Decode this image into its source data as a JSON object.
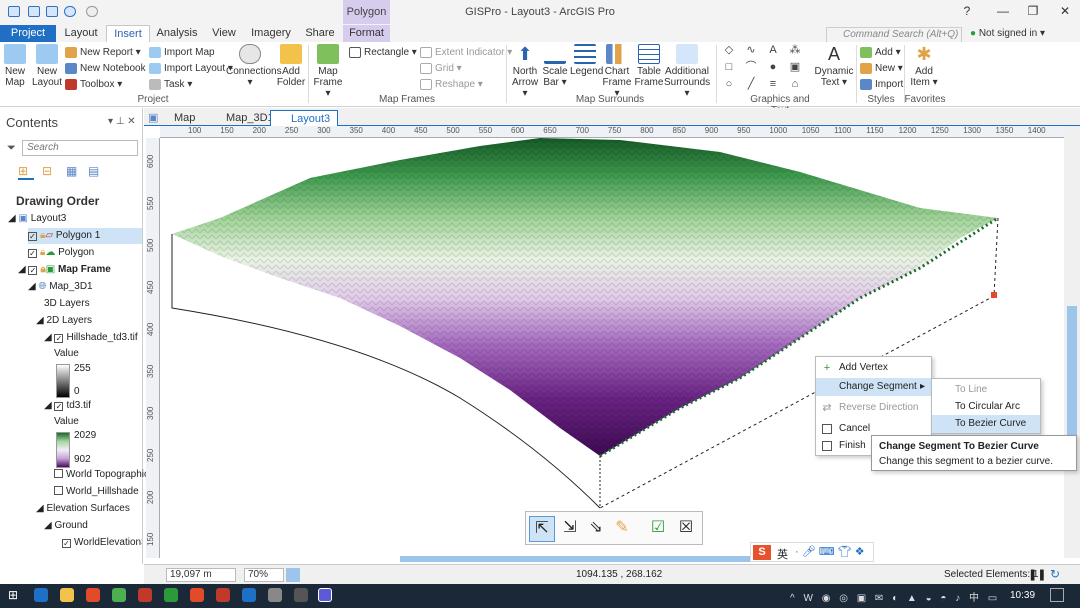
{
  "app": {
    "title": "GISPro - Layout3 - ArcGIS Pro",
    "context_tab_title": "Polygon",
    "help": "?",
    "signin": "Not signed in",
    "command_search_placeholder": "Command Search (Alt+Q)"
  },
  "tabs": [
    "Project",
    "Layout",
    "Insert",
    "Analysis",
    "View",
    "Imagery",
    "Share",
    "Format"
  ],
  "active_tab": "Insert",
  "ribbon": {
    "project_group": {
      "label": "Project",
      "new_map": "New Map",
      "new_layout": "New Layout",
      "new_report": "New Report",
      "new_notebook": "New Notebook",
      "toolbox": "Toolbox",
      "import_map": "Import Map",
      "import_layout": "Import Layout",
      "task": "Task",
      "connections": "Connections",
      "add_folder": "Add Folder"
    },
    "map_frames": {
      "label": "Map Frames",
      "map_frame": "Map Frame",
      "rectangle": "Rectangle",
      "extent_indicator": "Extent Indicator",
      "grid": "Grid",
      "reshape": "Reshape"
    },
    "map_surrounds": {
      "label": "Map Surrounds",
      "north_arrow": "North Arrow",
      "scale_bar": "Scale Bar",
      "legend": "Legend",
      "chart_frame": "Chart Frame",
      "table_frame": "Table Frame",
      "additional_surrounds": "Additional Surrounds"
    },
    "graphics_text": {
      "label": "Graphics and Text",
      "dynamic_text": "Dynamic Text"
    },
    "styles": {
      "label": "Styles",
      "add": "Add",
      "new": "New",
      "import": "Import"
    },
    "favorites": {
      "label": "Favorites",
      "add_item": "Add Item"
    }
  },
  "contents": {
    "title": "Contents",
    "search_placeholder": "Search",
    "drawing_order": "Drawing Order",
    "items": [
      "Layout3",
      "Polygon 1",
      "Polygon",
      "Map Frame",
      "Map_3D1",
      "3D Layers",
      "2D Layers",
      "Hillshade_td3.tif",
      "Value",
      "255",
      "0",
      "td3.tif",
      "Value",
      "2029",
      "902",
      "World Topographic",
      "World_Hillshade",
      "Elevation Surfaces",
      "Ground",
      "WorldElevation3D"
    ]
  },
  "view_tabs": [
    "Map",
    "Map_3D1",
    "Layout3"
  ],
  "ruler_top": [
    "100",
    "150",
    "200",
    "250",
    "300",
    "350",
    "400",
    "450",
    "500",
    "550",
    "600",
    "650",
    "700",
    "750",
    "800",
    "850",
    "900",
    "950",
    "1000",
    "1050",
    "1100",
    "1150",
    "1200",
    "1250",
    "1300",
    "1350",
    "1400"
  ],
  "ruler_left": [
    "600",
    "550",
    "500",
    "450",
    "400",
    "350",
    "300",
    "250",
    "200",
    "150"
  ],
  "context_menu": {
    "add_vertex": "Add Vertex",
    "change_segment": "Change Segment",
    "reverse_direction": "Reverse Direction",
    "cancel": "Cancel",
    "finish": "Finish"
  },
  "submenu": {
    "to_line": "To Line",
    "to_circular_arc": "To Circular Arc",
    "to_bezier": "To Bezier Curve"
  },
  "tooltip": {
    "title": "Change Segment To Bezier Curve",
    "body": "Change this segment to a bezier curve."
  },
  "status": {
    "scale": "19,097 m",
    "zoom": "70%",
    "coords": "1094.135 , 268.162",
    "selected": "Selected Elements: 1"
  },
  "ime": {
    "lang": "英"
  },
  "taskbar": {
    "time": "10:39"
  },
  "colors": {
    "accent": "#1f6fc5",
    "terrain_high": "#1b6b2e",
    "terrain_low": "#4b0a5e"
  }
}
